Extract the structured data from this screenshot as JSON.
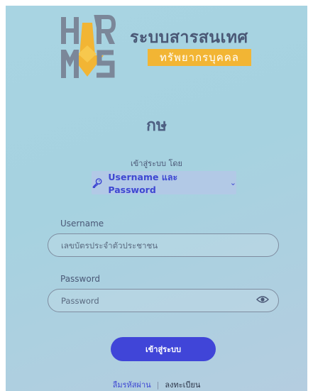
{
  "brand": {
    "title": "ระบบสารสนเทศ",
    "subtitle": "ทรัพยากรบุคคล",
    "logo_letters": [
      "H",
      "R",
      "M",
      "S"
    ]
  },
  "org_name": "กษ",
  "login": {
    "by_label": "เข้าสู่ระบบ โดย",
    "method_label": "Username และ Password",
    "method_icon": "key-icon",
    "username_label": "Username",
    "username_placeholder": "เลขบัตรประจำตัวประชาชน",
    "password_label": "Password",
    "password_placeholder": "Password",
    "password_toggle_icon": "eye-icon",
    "submit_label": "เข้าสู่ระบบ"
  },
  "footer": {
    "forgot_label": "ลืมรหัสผ่าน",
    "separator": "|",
    "register_label": "ลงทะเบียน"
  },
  "colors": {
    "background": "#a8d4e2",
    "accent_blue": "#3e47d2",
    "button": "#4045d8",
    "brand_yellow": "#f2b534",
    "text_slate": "#4a5876"
  }
}
